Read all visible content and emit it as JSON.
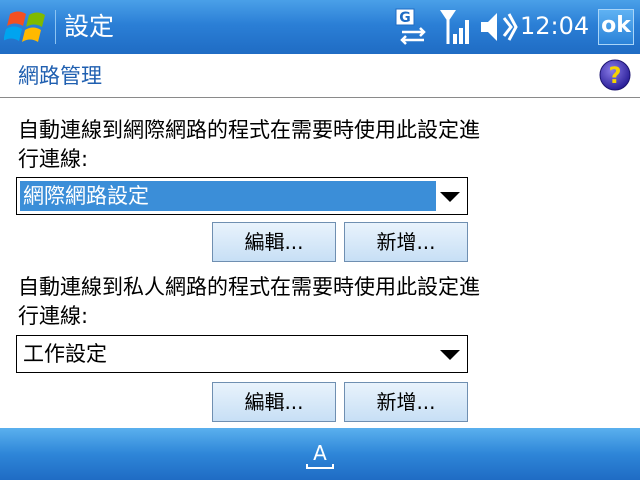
{
  "titlebar": {
    "title": "設定",
    "clock": "12:04",
    "ok_label": "ok",
    "icons": [
      "windows-start-icon",
      "gprs-connection-icon",
      "signal-strength-icon",
      "speaker-volume-icon"
    ]
  },
  "header": {
    "title": "網路管理",
    "help_icon": "help-icon",
    "help_glyph": "?"
  },
  "internet_section": {
    "label": "自動連線到網際網路的程式在需要時使用此設定進行連線:",
    "selected": "網際網路設定",
    "edit_label": "編輯...",
    "new_label": "新增..."
  },
  "private_section": {
    "label": "自動連線到私人網路的程式在需要時使用此設定進行連線:",
    "selected": "工作設定",
    "edit_label": "編輯...",
    "new_label": "新增..."
  },
  "menubar": {
    "sip_icon": "input-panel-keyboard-icon",
    "sip_glyph": "A"
  },
  "colors": {
    "bar_blue": "#2b7fd6",
    "header_text": "#1f5fb0",
    "selection": "#3b8ed8",
    "button_face": "#c7dff5"
  }
}
